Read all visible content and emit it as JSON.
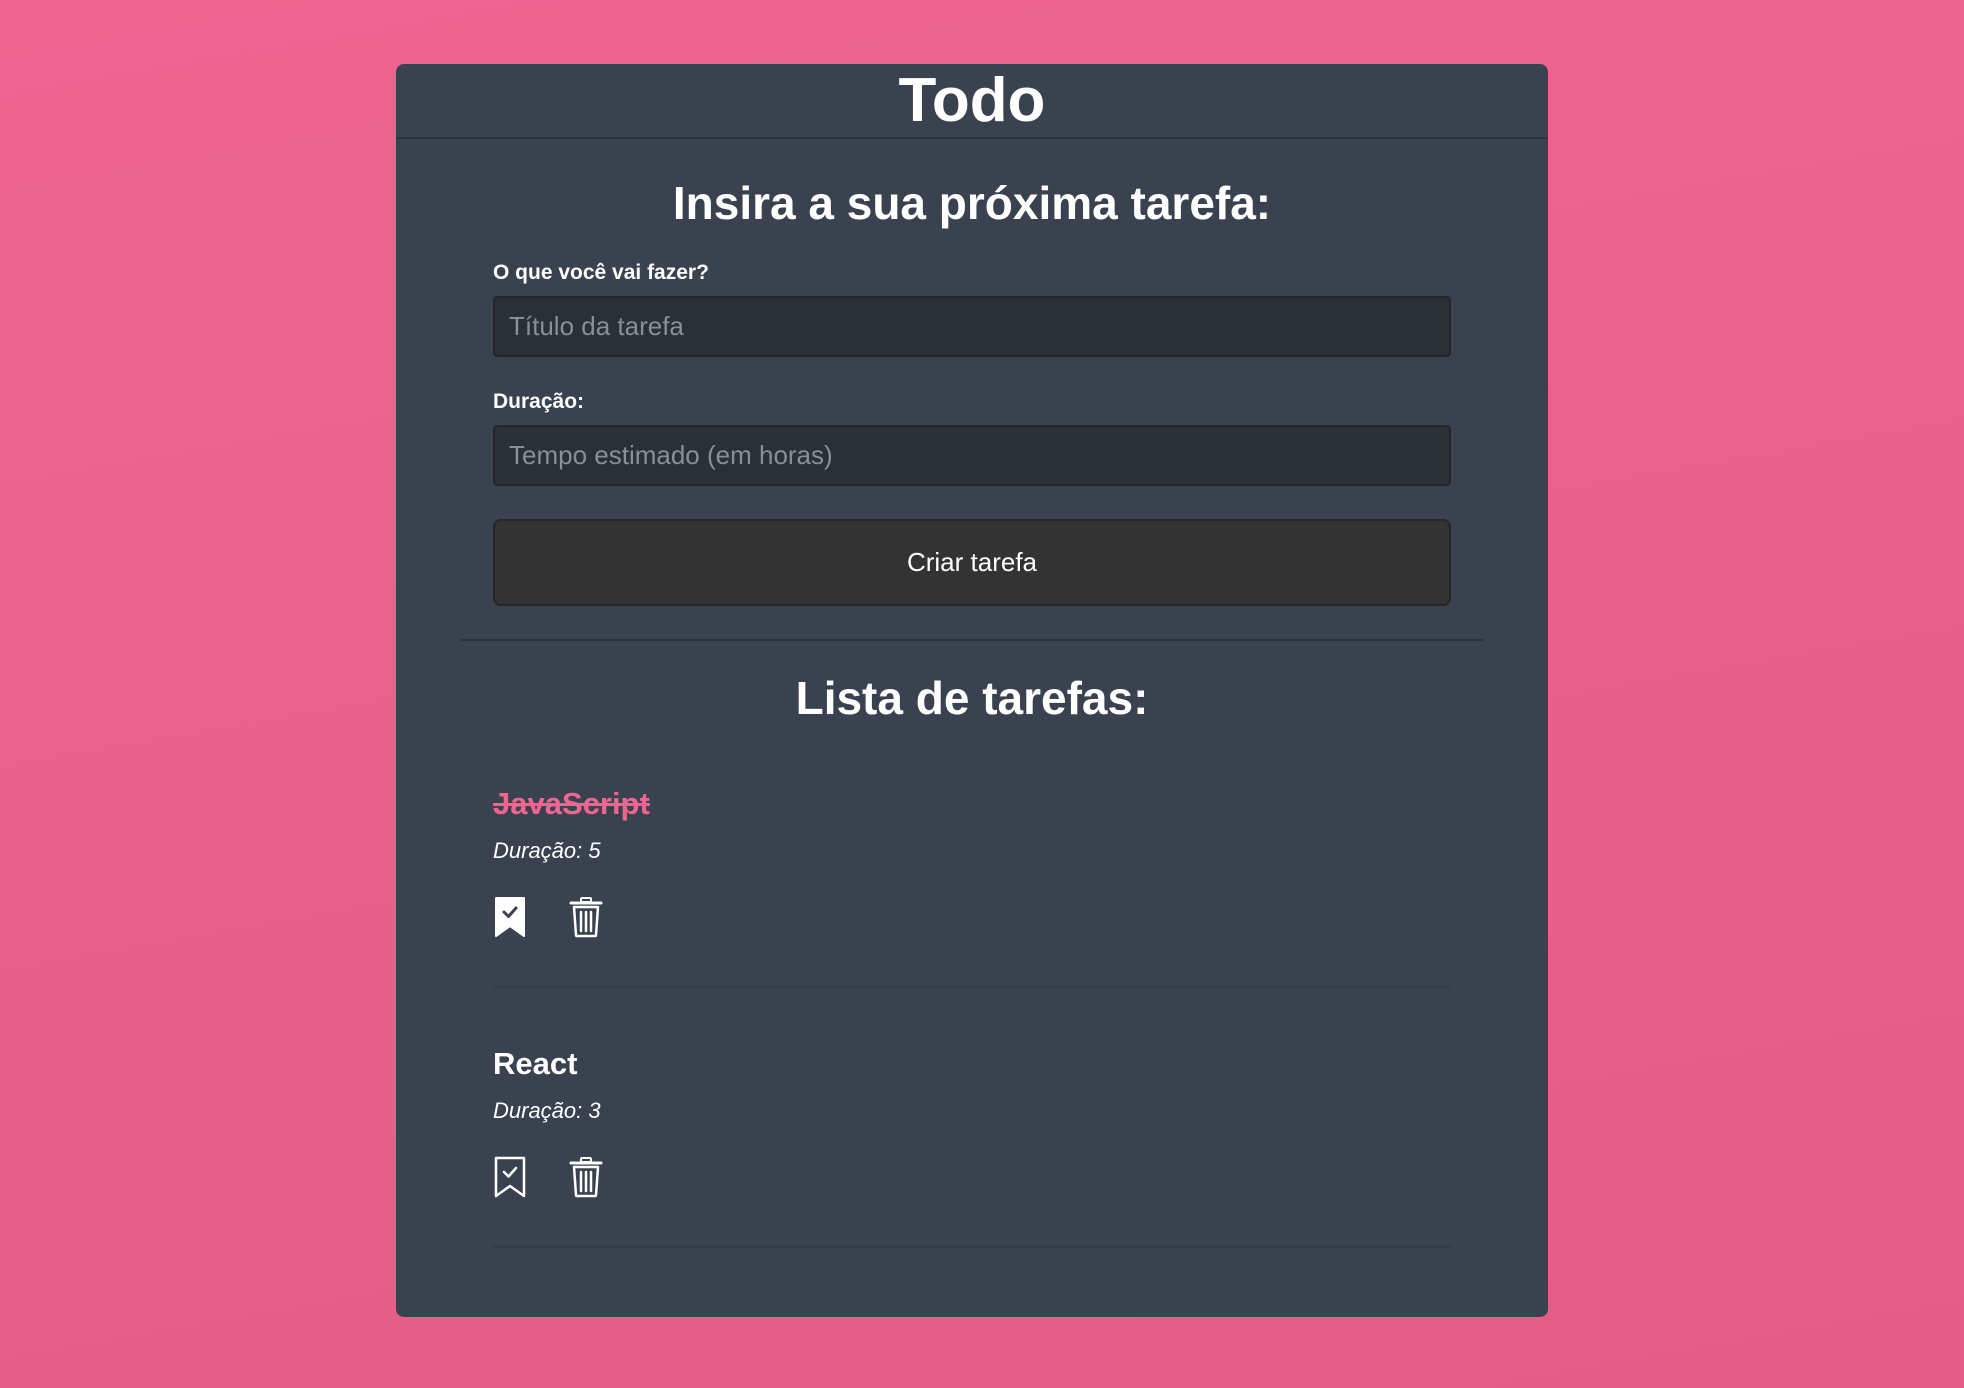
{
  "header": {
    "title": "Todo"
  },
  "form": {
    "heading": "Insira a sua próxima tarefa:",
    "title_label": "O que você vai fazer?",
    "title_placeholder": "Título da tarefa",
    "title_value": "",
    "duration_label": "Duração:",
    "duration_placeholder": "Tempo estimado (em horas)",
    "duration_value": "",
    "submit_label": "Criar tarefa"
  },
  "list": {
    "heading": "Lista de tarefas:",
    "tasks": [
      {
        "title": "JavaScript",
        "duration_text": "Duração: 5",
        "done": true,
        "done_icon": "bookmark-check-filled-icon",
        "delete_icon": "trash-icon"
      },
      {
        "title": "React",
        "duration_text": "Duração: 3",
        "done": false,
        "done_icon": "bookmark-check-outline-icon",
        "delete_icon": "trash-icon"
      }
    ]
  },
  "colors": {
    "background": "#ee6592",
    "card": "#39424e",
    "accent": "#ee6592",
    "input_bg": "#2b3036",
    "button_bg": "#333333",
    "text": "#ffffff"
  }
}
